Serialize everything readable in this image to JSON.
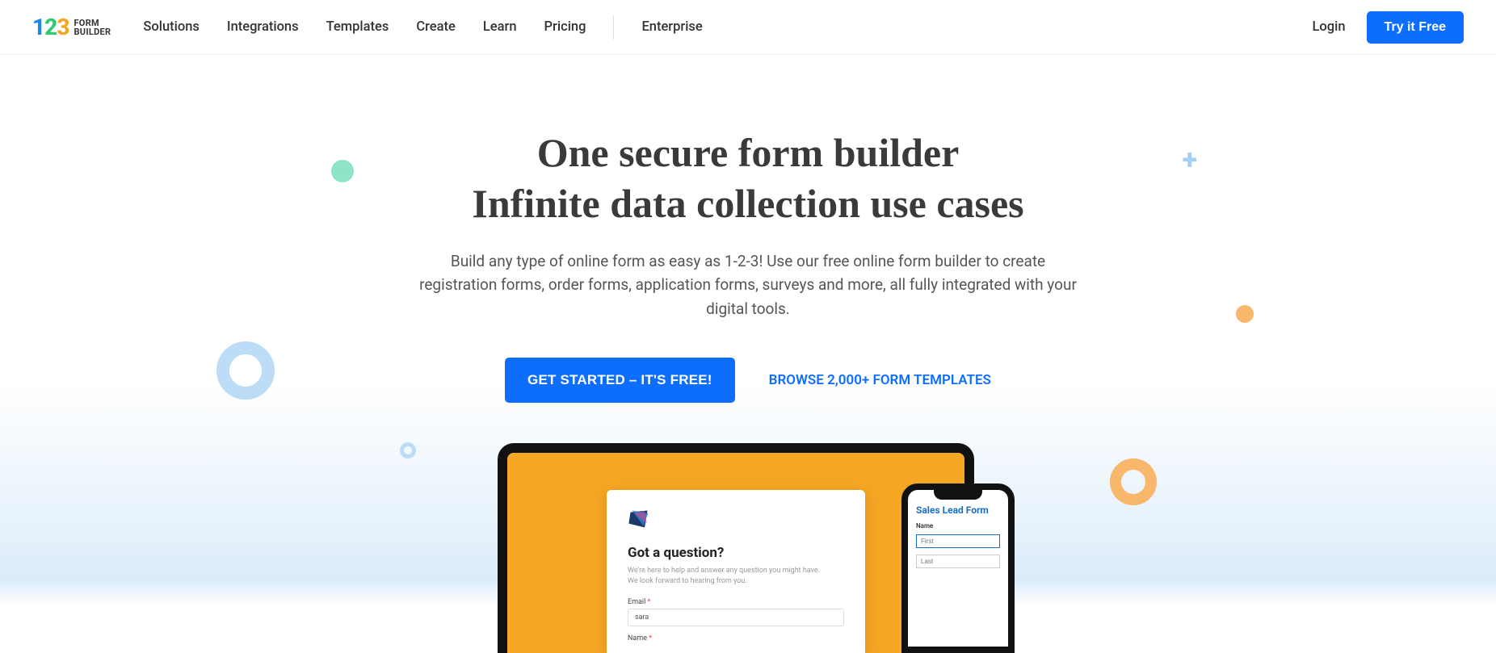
{
  "logo": {
    "text_top": "FORM",
    "text_bottom": "BUILDER"
  },
  "nav": {
    "items": [
      "Solutions",
      "Integrations",
      "Templates",
      "Create",
      "Learn",
      "Pricing"
    ],
    "enterprise": "Enterprise"
  },
  "header": {
    "login": "Login",
    "try": "Try it Free"
  },
  "hero": {
    "title_line1": "One secure form builder",
    "title_line2": "Infinite data collection use cases",
    "subtitle": "Build any type of online form as easy as 1-2-3! Use our free online form builder to create registration forms, order forms, application forms, surveys and more, all fully integrated with your digital tools.",
    "cta_primary": "GET STARTED – IT'S FREE!",
    "cta_secondary": "BROWSE 2,000+ FORM TEMPLATES"
  },
  "laptop_form": {
    "heading": "Got a question?",
    "desc1": "We're here to help and answer any question you might have.",
    "desc2": "We look forward to hearing from you.",
    "email_label": "Email",
    "email_value": "sara",
    "name_label": "Name"
  },
  "phone_form": {
    "title": "Sales Lead Form",
    "name_label": "Name",
    "first_placeholder": "First",
    "last_placeholder": "Last"
  }
}
